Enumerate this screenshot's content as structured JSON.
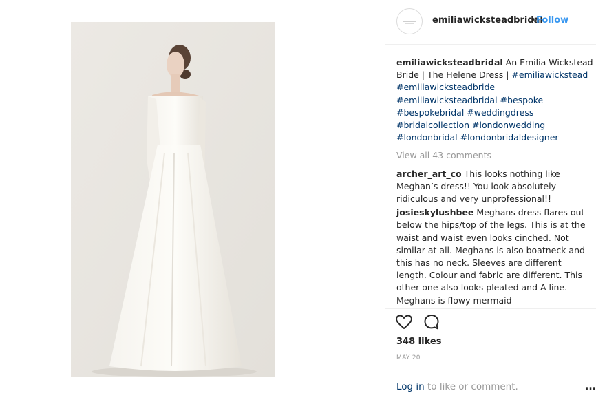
{
  "post": {
    "image_alt": "Model in white long-sleeve off-shoulder bridal gown",
    "author": {
      "handle": "emiliawicksteadbridal",
      "follow_label": "Follow",
      "separator": "•"
    },
    "caption": {
      "author": "emiliawicksteadbridal",
      "text": " An Emilia Wickstead Bride | The Helene Dress | ",
      "hashtags": [
        "#emiliawickstead",
        "#emiliawicksteadbride",
        "#emiliawicksteadbridal",
        "#bespoke",
        "#bespokebridal",
        "#weddingdress",
        "#bridalcollection",
        "#londonwedding",
        "#londonbridal",
        "#londonbridaldesigner"
      ]
    },
    "view_all_comments": "View all 43 comments",
    "comments": [
      {
        "user": "archer_art_co",
        "text": " This looks nothing like Meghan’s dress!! You look absolutely ridiculous and very unprofessional!!"
      },
      {
        "user": "josieskylushbee",
        "text": " Meghans dress flares out below the hips/top of the legs. This is at the waist and waist even looks cinched. Not similar at all. Meghans is also boatneck and this has no neck. Sleeves are different length. Colour and fabric are different. This other one also looks pleated and A line. Meghans is flowy mermaid"
      }
    ],
    "actions": {
      "like_icon": "heart-icon",
      "comment_icon": "comment-bubble-icon"
    },
    "likes": "348 likes",
    "date": "MAY 20",
    "footer": {
      "login_label": "Log in",
      "login_suffix": " to like or comment.",
      "more_label": "..."
    }
  }
}
